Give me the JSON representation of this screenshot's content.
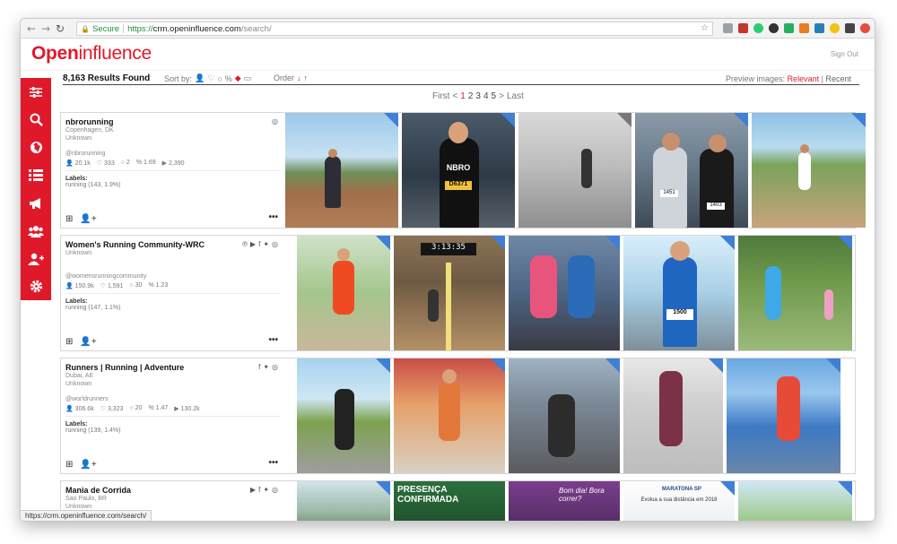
{
  "browser": {
    "secure_label": "Secure",
    "url_scheme": "https://",
    "url_host": "crm.openinfluence.com",
    "url_path": "/search/",
    "status_url": "https://crm.openinfluence.com/search/"
  },
  "app": {
    "logo_open": "Open",
    "logo_influence": "influence",
    "sign_out": "Sign Out"
  },
  "toolbar": {
    "results": "8,163 Results Found",
    "sort_by": "Sort by:",
    "order": "Order",
    "preview_label": "Preview images:",
    "relevant": "Relevant",
    "sep": "|",
    "recent": "Recent"
  },
  "pager": {
    "first": "First",
    "prev": "<",
    "pages": [
      "1",
      "2",
      "3",
      "4",
      "5"
    ],
    "next": ">",
    "last": "Last"
  },
  "sidebar": [
    "filter-sliders",
    "search",
    "globe",
    "list",
    "megaphone",
    "users-group",
    "add-user",
    "settings"
  ],
  "influencers": [
    {
      "name": "nbrorunning",
      "location": "Copenhagen, DK",
      "gender": "Unknown",
      "handle": "@nbrorunning",
      "followers": "20.1k",
      "likes": "333",
      "comments": "2",
      "engagement": "1.69",
      "videos": "2,390",
      "labels_heading": "Labels:",
      "labels": "running (143, 1.9%)",
      "socials": [
        "instagram-icon"
      ]
    },
    {
      "name": "Women's Running Community-WRC",
      "location": "",
      "gender": "Unknown",
      "handle": "@womensrunningcommunity",
      "followers": "150.9k",
      "likes": "1,591",
      "comments": "30",
      "engagement": "1.23",
      "videos": "",
      "labels_heading": "Labels:",
      "labels": "running (147, 1.1%)",
      "socials": [
        "pinterest-icon",
        "youtube-icon",
        "facebook-icon",
        "twitter-icon",
        "instagram-icon"
      ]
    },
    {
      "name": "Runners | Running | Adventure",
      "location": "Dubai, AE",
      "gender": "Unknown",
      "handle": "@worldrunners",
      "followers": "306.6k",
      "likes": "3,323",
      "comments": "20",
      "engagement": "1.47",
      "videos": "130.2k",
      "labels_heading": "Labels:",
      "labels": "running (139, 1.4%)",
      "socials": [
        "facebook-icon",
        "twitter-icon",
        "instagram-icon"
      ]
    },
    {
      "name": "Mania de Corrida",
      "location": "Sao Paulo, BR",
      "gender": "Unknown",
      "handle": "",
      "followers": "",
      "likes": "",
      "comments": "",
      "engagement": "",
      "videos": "",
      "labels_heading": "",
      "labels": "",
      "socials": [
        "youtube-icon",
        "facebook-icon",
        "twitter-icon",
        "instagram-icon"
      ]
    }
  ],
  "photo_text": {
    "bib_1": "D6371",
    "nbro": "NBRO",
    "bib_2": "1451",
    "bib_3": "1403",
    "clock": "3:13:35",
    "bib_4": "1500",
    "banner_1": "PRESENÇA CONFIRMADA",
    "banner_2": "Bom dia! Bora correr?",
    "banner_3": "MARATONA SP",
    "banner_4": "Evolua a sua distância em 2018"
  },
  "colors": {
    "brand_red": "#e0192a",
    "badge_blue": "#3f7fd6"
  }
}
